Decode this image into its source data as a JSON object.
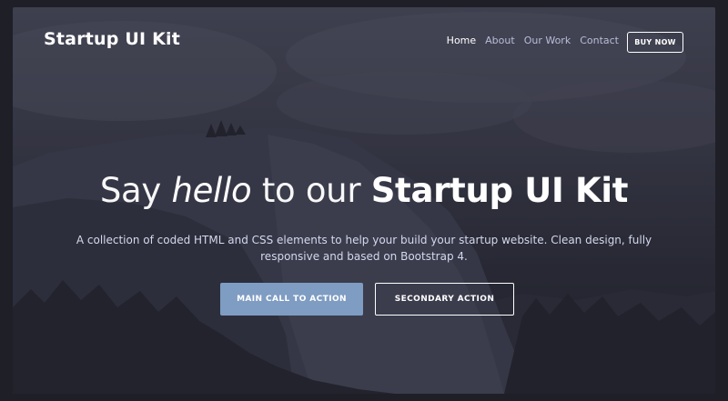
{
  "brand": {
    "name": "Startup UI Kit"
  },
  "nav": {
    "links": [
      {
        "label": "Home",
        "active": true
      },
      {
        "label": "About",
        "active": false
      },
      {
        "label": "Our Work",
        "active": false
      },
      {
        "label": "Contact",
        "active": false
      }
    ],
    "cta_label": "BUY NOW"
  },
  "hero": {
    "title_prefix": "Say",
    "title_emphasis": "hello",
    "title_middle": "to our",
    "title_strong": "Startup UI Kit",
    "subtitle": "A collection of coded HTML and CSS elements to help your build your startup website. Clean design, fully responsive and based on Bootstrap 4.",
    "primary_action": "MAIN CALL TO ACTION",
    "secondary_action": "SECONDARY ACTION"
  },
  "colors": {
    "page_background": "#1e1f27",
    "primary_button": "#7f9cc2",
    "nav_link": "#b9bdd6",
    "text": "#ffffff"
  },
  "background_image": "mountain-landscape-dark-overlay"
}
